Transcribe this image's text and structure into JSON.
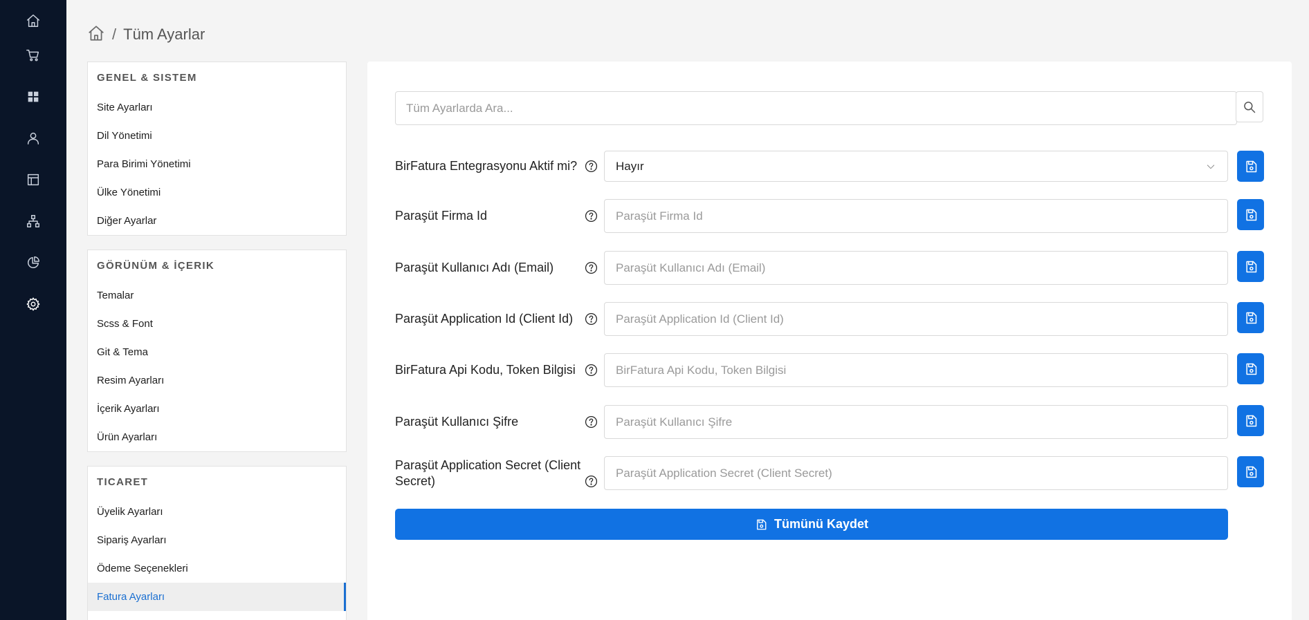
{
  "rail": {
    "items": [
      {
        "icon": "home-icon"
      },
      {
        "icon": "cart-icon"
      },
      {
        "icon": "dashboard-grid-icon"
      },
      {
        "icon": "user-icon"
      },
      {
        "icon": "layout-icon"
      },
      {
        "icon": "sitemap-icon"
      },
      {
        "icon": "pie-chart-icon"
      },
      {
        "icon": "gear-icon"
      }
    ],
    "active_icon": "gear-icon"
  },
  "breadcrumb": {
    "home_icon": "home-icon",
    "separator": "/",
    "current": "Tüm Ayarlar"
  },
  "settings_nav": {
    "sections": [
      {
        "heading": "GENEL & SISTEM",
        "items": [
          "Site Ayarları",
          "Dil Yönetimi",
          "Para Birimi Yönetimi",
          "Ülke Yönetimi",
          "Diğer Ayarlar"
        ]
      },
      {
        "heading": "GÖRÜNÜM & İÇERIK",
        "items": [
          "Temalar",
          "Scss & Font",
          "Git & Tema",
          "Resim Ayarları",
          "İçerik Ayarları",
          "Ürün Ayarları"
        ]
      },
      {
        "heading": "TICARET",
        "items": [
          "Üyelik Ayarları",
          "Sipariş Ayarları",
          "Ödeme Seçenekleri",
          "Fatura Ayarları"
        ]
      }
    ],
    "active_item": "Fatura Ayarları"
  },
  "search": {
    "placeholder": "Tüm Ayarlarda Ara...",
    "value": "",
    "icon": "search-icon"
  },
  "form": {
    "fields": [
      {
        "label": "BirFatura Entegrasyonu Aktif mi?",
        "type": "select",
        "value": "Hayır",
        "placeholder": ""
      },
      {
        "label": "Paraşüt Firma Id",
        "type": "text",
        "value": "",
        "placeholder": "Paraşüt Firma Id"
      },
      {
        "label": "Paraşüt Kullanıcı Adı (Email)",
        "type": "text",
        "value": "",
        "placeholder": "Paraşüt Kullanıcı Adı (Email)"
      },
      {
        "label": "Paraşüt Application Id (Client Id)",
        "type": "text",
        "value": "",
        "placeholder": "Paraşüt Application Id (Client Id)"
      },
      {
        "label": "BirFatura Api Kodu, Token Bilgisi",
        "type": "text",
        "value": "",
        "placeholder": "BirFatura Api Kodu, Token Bilgisi"
      },
      {
        "label": "Paraşüt Kullanıcı Şifre",
        "type": "text",
        "value": "",
        "placeholder": "Paraşüt Kullanıcı Şifre"
      },
      {
        "label": "Paraşüt Application Secret (Client Secret)",
        "type": "text",
        "value": "",
        "placeholder": "Paraşüt Application Secret (Client Secret)"
      }
    ],
    "save_all_label": "Tümünü Kaydet"
  },
  "colors": {
    "rail_bg": "#0a1528",
    "primary": "#1172e3",
    "active_nav_text": "#1a6fd1",
    "page_bg": "#f4f4f4"
  }
}
